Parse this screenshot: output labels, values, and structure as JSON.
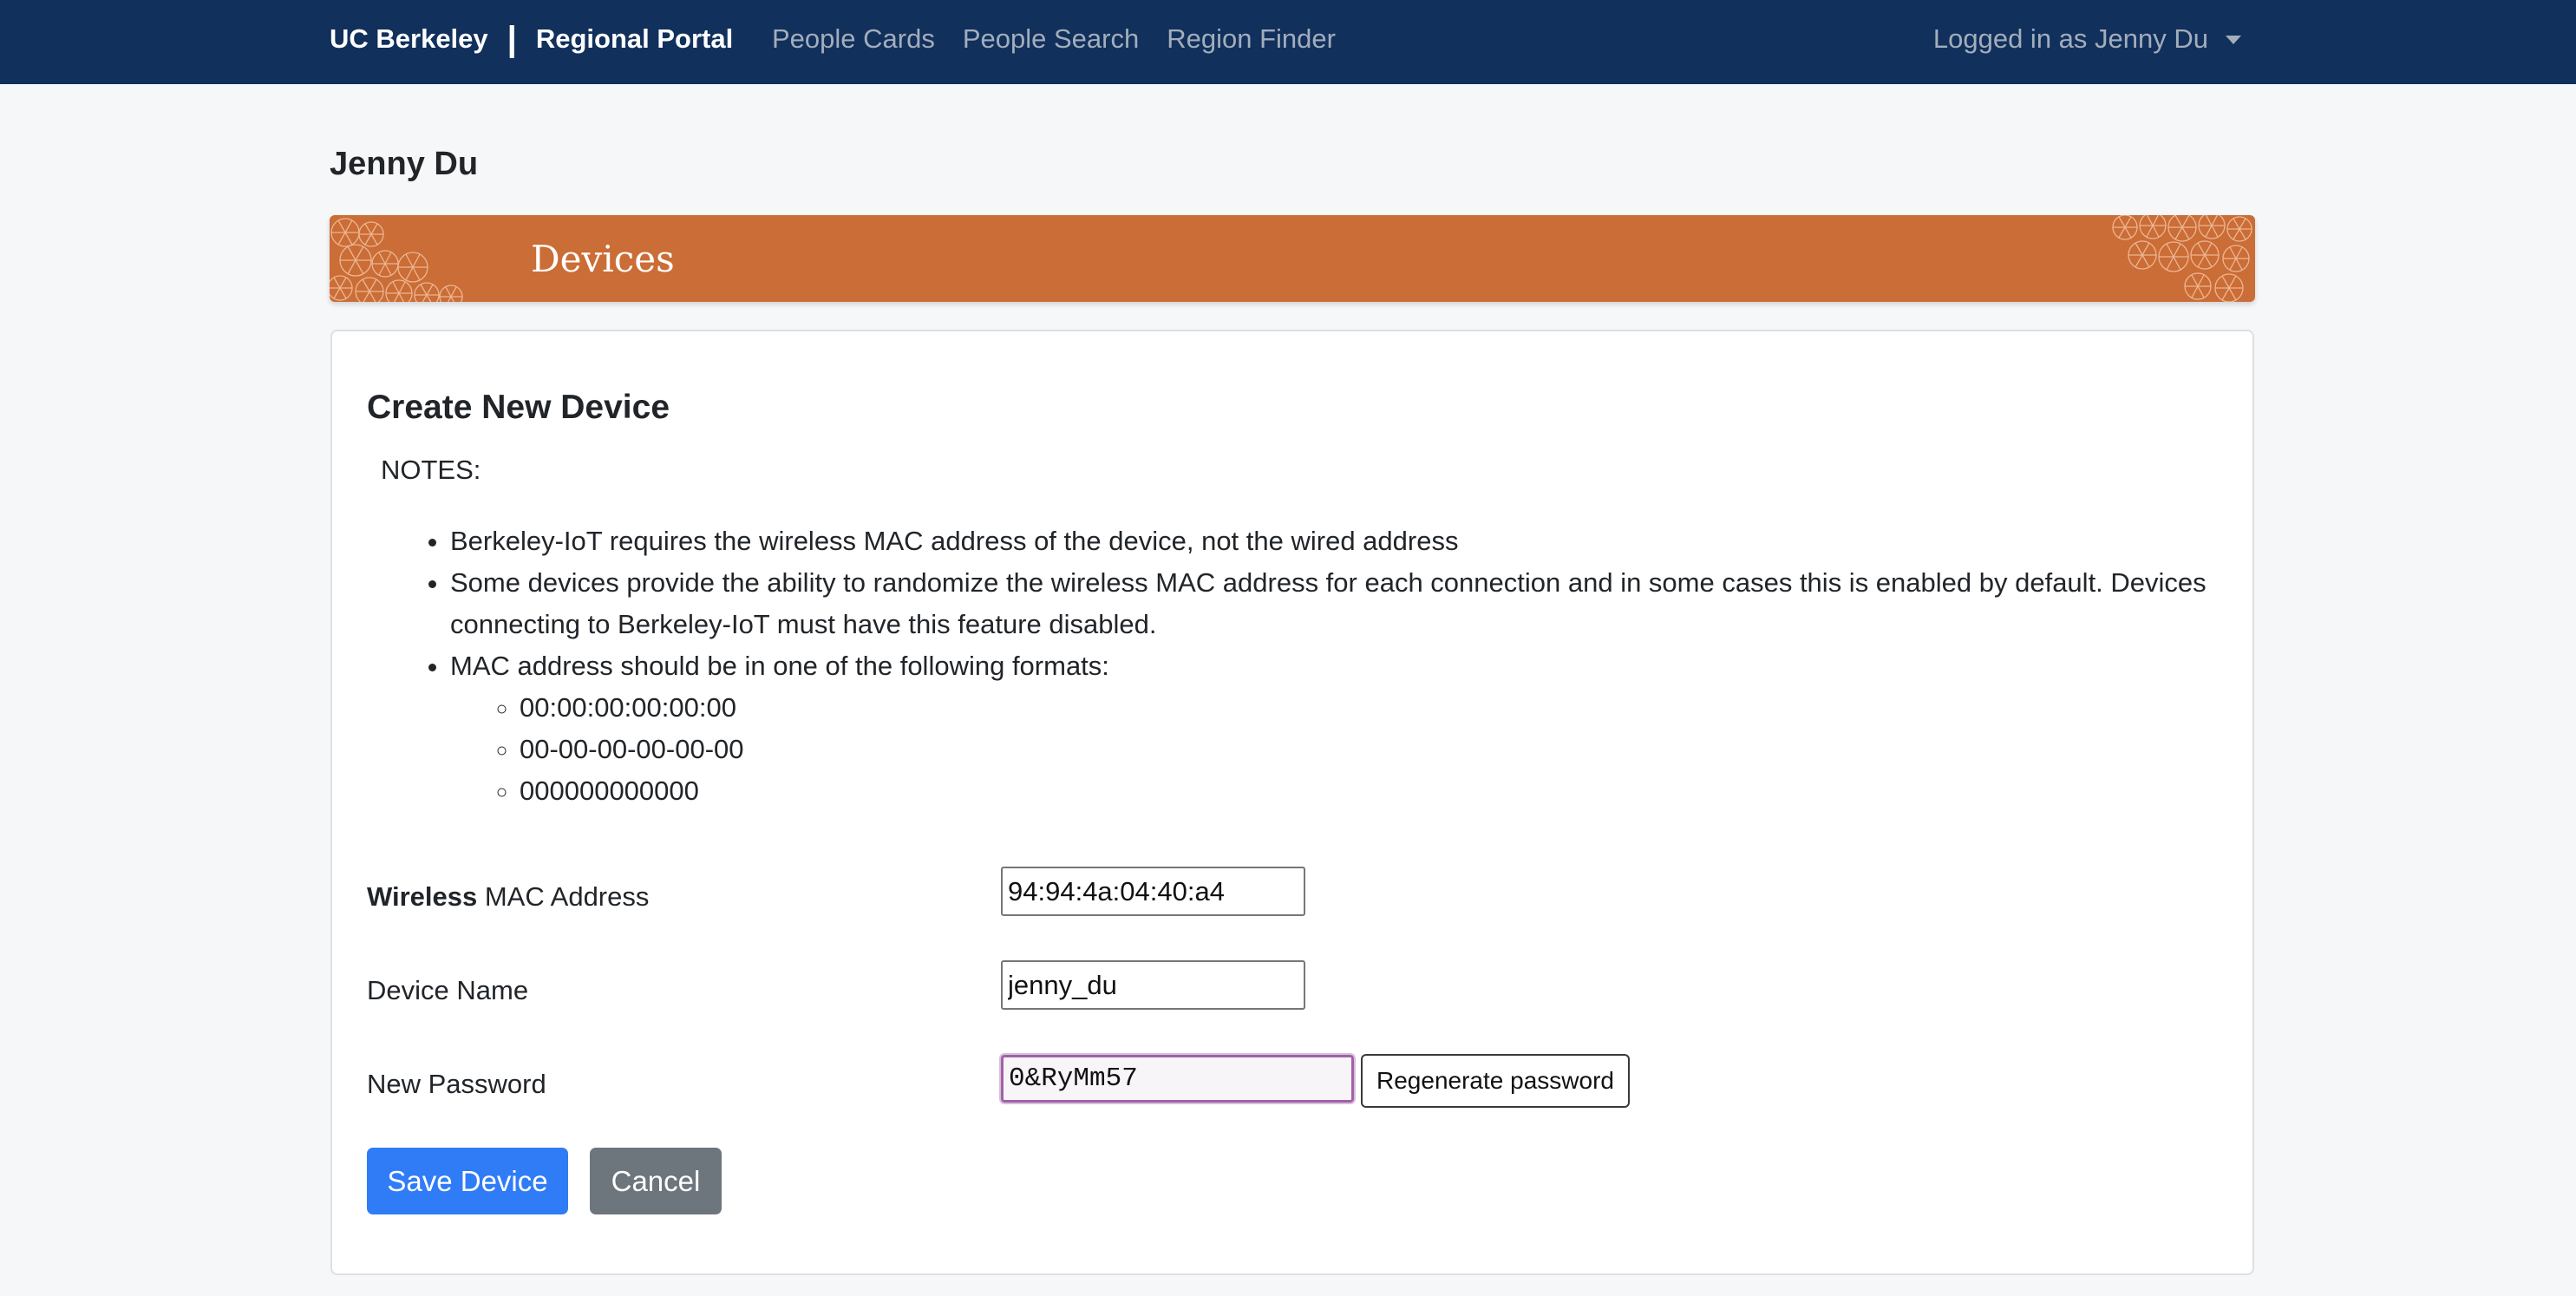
{
  "navbar": {
    "brand_org": "UC Berkeley",
    "brand_separator": "|",
    "brand_app": "Regional Portal",
    "links": [
      "People Cards",
      "People Search",
      "Region Finder"
    ],
    "user_menu": "Logged in as Jenny Du"
  },
  "page": {
    "person_name": "Jenny Du"
  },
  "banner": {
    "title": "Devices"
  },
  "form": {
    "title": "Create New Device",
    "notes_label": "NOTES:",
    "notes": [
      "Berkeley-IoT requires the wireless MAC address of the device, not the wired address",
      "Some devices provide the ability to randomize the wireless MAC address for each connection and in some cases this is enabled by default. Devices connecting to Berkeley-IoT must have this feature disabled.",
      "MAC address should be in one of the following formats:"
    ],
    "mac_formats": [
      "00:00:00:00:00:00",
      "00-00-00-00-00-00",
      "000000000000"
    ],
    "mac_label_bold": "Wireless",
    "mac_label_rest": " MAC Address",
    "mac_value": "94:94:4a:04:40:a4",
    "device_name_label": "Device Name",
    "device_name_value": "jenny_du",
    "password_label": "New Password",
    "password_value": "0&RyMm57",
    "regenerate_label": "Regenerate password",
    "save_label": "Save Device",
    "cancel_label": "Cancel"
  },
  "colors": {
    "navbar_bg": "#11305c",
    "banner_bg": "#cb6d36",
    "primary_button": "#2f7cf6",
    "secondary_button": "#6d757d",
    "focus_border": "#a260a8"
  },
  "icons": {
    "user_menu_caret": "caret-down-icon",
    "banner_pattern": "geometric-pattern"
  }
}
